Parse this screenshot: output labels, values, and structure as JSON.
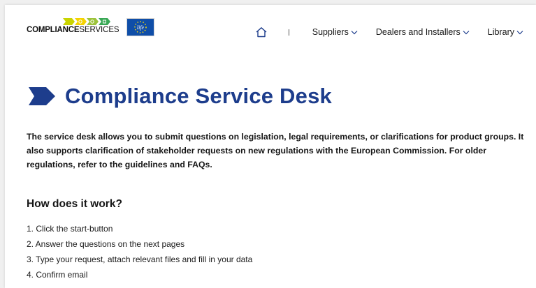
{
  "logo": {
    "text_bold": "COMPLIANCE",
    "text_light": "SERVICES",
    "arrow_colors": [
      "#c9d400",
      "#f5d300",
      "#9cc33b",
      "#3aa856"
    ]
  },
  "colors": {
    "accent": "#1d3d8c",
    "eu_blue": "#0f4ea8",
    "eu_stars": "#ffdd00"
  },
  "nav": {
    "home_icon": "home-icon",
    "items": [
      {
        "label": "Suppliers"
      },
      {
        "label": "Dealers and Installers"
      },
      {
        "label": "Library"
      }
    ]
  },
  "main": {
    "title": "Compliance Service Desk",
    "intro": "The service desk allows you to submit questions on legislation, legal requirements, or clarifications for product groups. It also supports clarification of stakeholder requests on new regulations with the European Commission. For older regulations, refer to the guidelines and FAQs.",
    "how_heading": "How does it work?",
    "steps": [
      "1. Click the start-button",
      "2. Answer the questions on the next pages",
      "3. Type your request, attach relevant files and fill in your data",
      "4. Confirm email"
    ]
  }
}
